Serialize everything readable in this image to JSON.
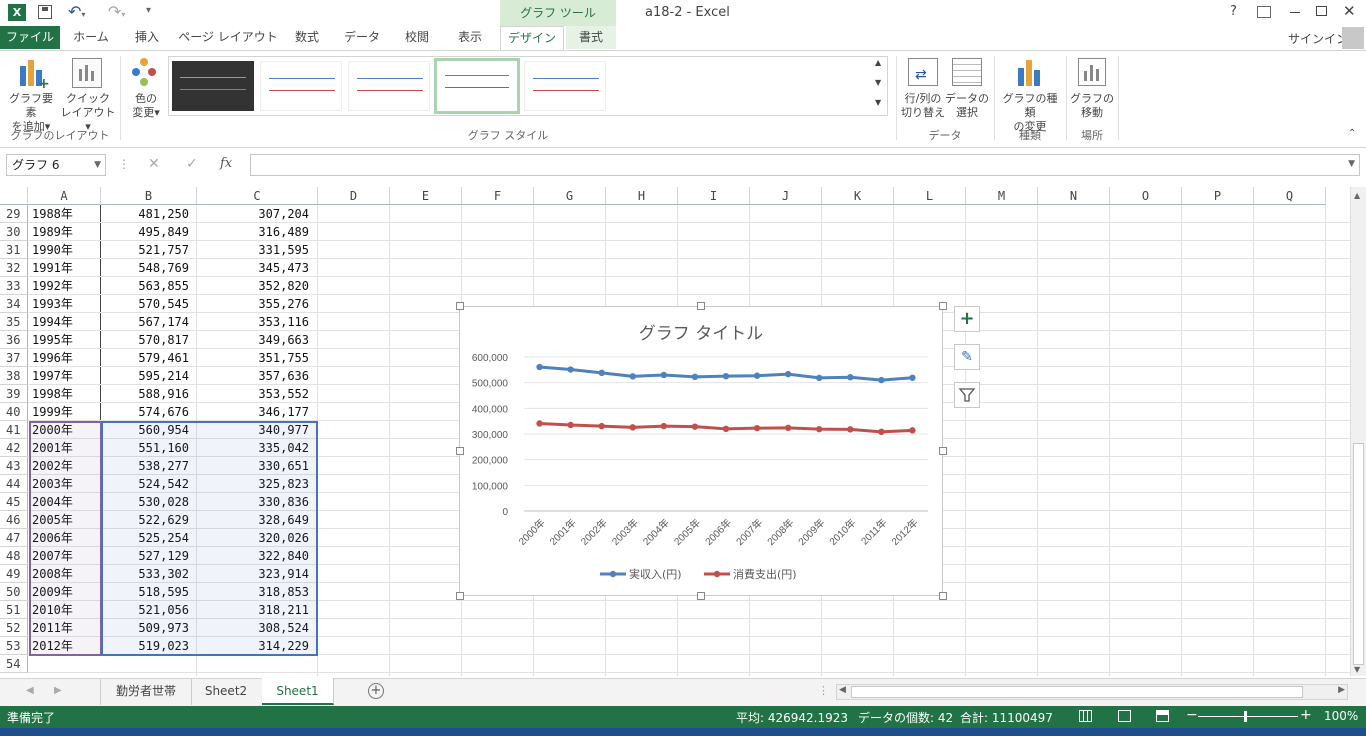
{
  "window": {
    "title": "a18-2 - Excel",
    "context_tab": "グラフ ツール",
    "help": "?",
    "signin": "サインイン"
  },
  "tabs": [
    "ファイル",
    "ホーム",
    "挿入",
    "ページ レイアウト",
    "数式",
    "データ",
    "校閲",
    "表示",
    "デザイン",
    "書式"
  ],
  "ribbon": {
    "add_element": [
      "グラフ要素",
      "を追加"
    ],
    "quick_layout": [
      "クイック",
      "レイアウト"
    ],
    "change_color": [
      "色の",
      "変更"
    ],
    "group_layout": "グラフのレイアウト",
    "group_styles": "グラフ スタイル",
    "switch_rowcol": [
      "行/列の",
      "切り替え"
    ],
    "select_data": [
      "データの",
      "選択"
    ],
    "group_data": "データ",
    "change_type": [
      "グラフの種類",
      "の変更"
    ],
    "group_type": "種類",
    "move_chart": [
      "グラフの",
      "移動"
    ],
    "group_location": "場所"
  },
  "formula_bar": {
    "name_box": "グラフ 6",
    "fx": "fx",
    "value": ""
  },
  "columns": [
    "A",
    "B",
    "C",
    "D",
    "E",
    "F",
    "G",
    "H",
    "I",
    "J",
    "K",
    "L",
    "M",
    "N",
    "O",
    "P",
    "Q"
  ],
  "rows": [
    {
      "n": "29",
      "a": "1988年",
      "b": "481,250",
      "c": "307,204"
    },
    {
      "n": "30",
      "a": "1989年",
      "b": "495,849",
      "c": "316,489"
    },
    {
      "n": "31",
      "a": "1990年",
      "b": "521,757",
      "c": "331,595"
    },
    {
      "n": "32",
      "a": "1991年",
      "b": "548,769",
      "c": "345,473"
    },
    {
      "n": "33",
      "a": "1992年",
      "b": "563,855",
      "c": "352,820"
    },
    {
      "n": "34",
      "a": "1993年",
      "b": "570,545",
      "c": "355,276"
    },
    {
      "n": "35",
      "a": "1994年",
      "b": "567,174",
      "c": "353,116"
    },
    {
      "n": "36",
      "a": "1995年",
      "b": "570,817",
      "c": "349,663"
    },
    {
      "n": "37",
      "a": "1996年",
      "b": "579,461",
      "c": "351,755"
    },
    {
      "n": "38",
      "a": "1997年",
      "b": "595,214",
      "c": "357,636"
    },
    {
      "n": "39",
      "a": "1998年",
      "b": "588,916",
      "c": "353,552"
    },
    {
      "n": "40",
      "a": "1999年",
      "b": "574,676",
      "c": "346,177"
    },
    {
      "n": "41",
      "a": "2000年",
      "b": "560,954",
      "c": "340,977"
    },
    {
      "n": "42",
      "a": "2001年",
      "b": "551,160",
      "c": "335,042"
    },
    {
      "n": "43",
      "a": "2002年",
      "b": "538,277",
      "c": "330,651"
    },
    {
      "n": "44",
      "a": "2003年",
      "b": "524,542",
      "c": "325,823"
    },
    {
      "n": "45",
      "a": "2004年",
      "b": "530,028",
      "c": "330,836"
    },
    {
      "n": "46",
      "a": "2005年",
      "b": "522,629",
      "c": "328,649"
    },
    {
      "n": "47",
      "a": "2006年",
      "b": "525,254",
      "c": "320,026"
    },
    {
      "n": "48",
      "a": "2007年",
      "b": "527,129",
      "c": "322,840"
    },
    {
      "n": "49",
      "a": "2008年",
      "b": "533,302",
      "c": "323,914"
    },
    {
      "n": "50",
      "a": "2009年",
      "b": "518,595",
      "c": "318,853"
    },
    {
      "n": "51",
      "a": "2010年",
      "b": "521,056",
      "c": "318,211"
    },
    {
      "n": "52",
      "a": "2011年",
      "b": "509,973",
      "c": "308,524"
    },
    {
      "n": "53",
      "a": "2012年",
      "b": "519,023",
      "c": "314,229"
    },
    {
      "n": "54",
      "a": "",
      "b": "",
      "c": ""
    }
  ],
  "chart_data": {
    "type": "line",
    "title": "グラフ タイトル",
    "categories": [
      "2000年",
      "2001年",
      "2002年",
      "2003年",
      "2004年",
      "2005年",
      "2006年",
      "2007年",
      "2008年",
      "2009年",
      "2010年",
      "2011年",
      "2012年"
    ],
    "series": [
      {
        "name": "実収入(円)",
        "color": "#4f81bd",
        "values": [
          560954,
          551160,
          538277,
          524542,
          530028,
          522629,
          525254,
          527129,
          533302,
          518595,
          521056,
          509973,
          519023
        ]
      },
      {
        "name": "消費支出(円)",
        "color": "#c0504d",
        "values": [
          340977,
          335042,
          330651,
          325823,
          330836,
          328649,
          320026,
          322840,
          323914,
          318853,
          318211,
          308524,
          314229
        ]
      }
    ],
    "ylim": [
      0,
      600000
    ],
    "yticks": [
      "0",
      "100,000",
      "200,000",
      "300,000",
      "400,000",
      "500,000",
      "600,000"
    ],
    "grid": true,
    "legend": "bottom"
  },
  "sheets": [
    "勤労者世帯",
    "Sheet2",
    "Sheet1"
  ],
  "active_sheet": "Sheet1",
  "status": {
    "ready": "準備完了",
    "average": "平均: 426942.1923",
    "count": "データの個数: 42",
    "sum": "合計: 11100497",
    "zoom": "100%"
  },
  "colors": {
    "accent": "#217346",
    "select_purple": "#8064a2",
    "select_blue": "#4472c4"
  }
}
